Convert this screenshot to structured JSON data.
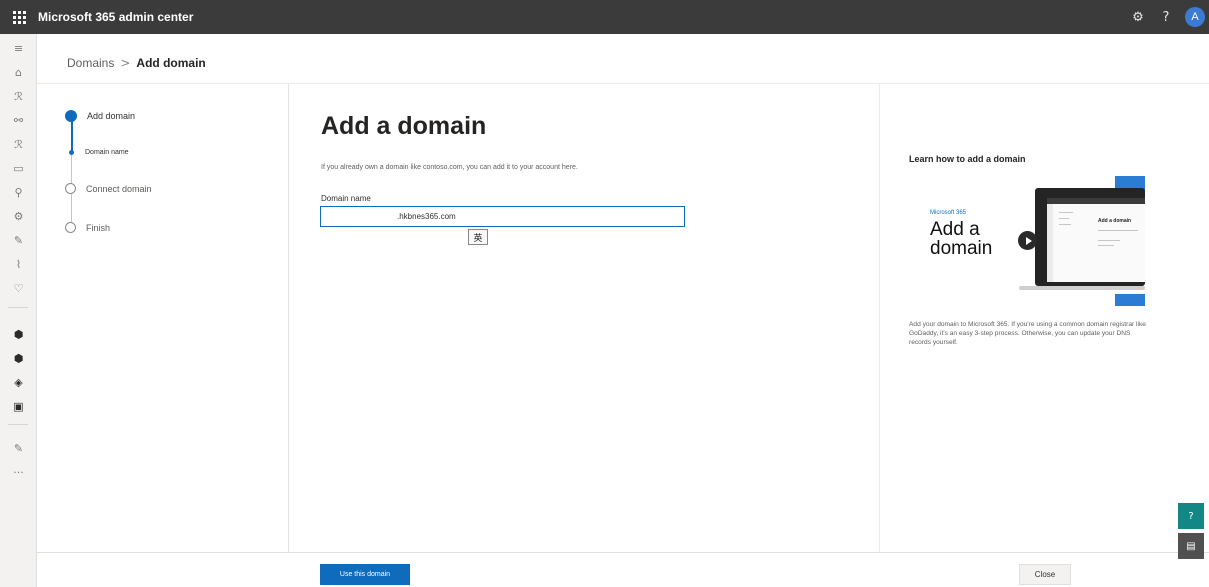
{
  "app": {
    "title": "Microsoft 365 admin center",
    "avatar_initial": "A"
  },
  "topbar": {
    "settings_icon": "⚙",
    "help_icon": "?"
  },
  "rail": {
    "icons": [
      "≡",
      "⌂",
      "ℛ",
      "⚯",
      "ℛ",
      "▭",
      "⚲",
      "⚙",
      "✎",
      "⌇",
      "♡",
      "⬢",
      "⬢",
      "◈",
      "▣",
      "✎",
      "···"
    ]
  },
  "breadcrumb": {
    "parent": "Domains",
    "separator": ">",
    "current": "Add domain"
  },
  "stepper": {
    "steps": [
      {
        "label": "Add domain",
        "state": "current"
      },
      {
        "label": "Domain name",
        "state": "sub-current"
      },
      {
        "label": "Connect domain",
        "state": "upcoming"
      },
      {
        "label": "Finish",
        "state": "upcoming"
      }
    ]
  },
  "main": {
    "title": "Add a domain",
    "intro": "If you already own a domain like contoso.com, you can add it to your account here.",
    "field_label": "Domain name",
    "field_value": ".hkbnes365.com",
    "ime_indicator": "英"
  },
  "learn": {
    "title": "Learn how to add a domain",
    "video_brand": "Microsoft 365",
    "video_title": "Add a domain",
    "video_screen_title": "Add a domain",
    "description": "Add your domain to Microsoft 365. If you're using a common domain registrar like GoDaddy, it's an easy 3-step process. Otherwise, you can update your DNS records yourself."
  },
  "footer": {
    "primary": "Use this domain",
    "close": "Close"
  },
  "floating": {
    "help_icon": "?",
    "feedback_icon": "▤"
  },
  "colors": {
    "brand": "#0f6cbd",
    "topbar": "#3b3b3b",
    "help_button": "#138686"
  }
}
